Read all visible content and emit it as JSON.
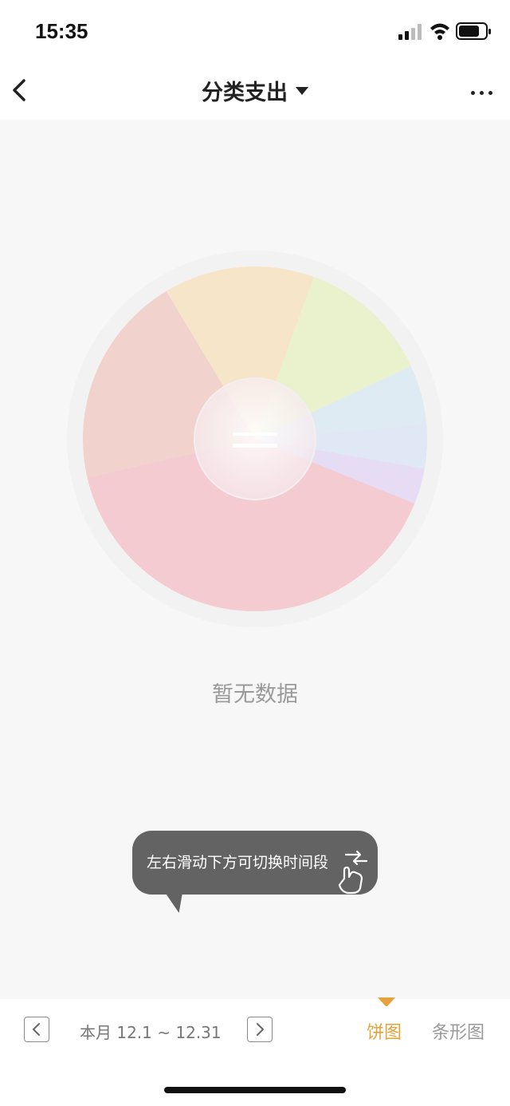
{
  "status_bar": {
    "time": "15:35"
  },
  "nav": {
    "title": "分类支出"
  },
  "main": {
    "empty_text": "暂无数据"
  },
  "tooltip": {
    "text": "左右滑动下方可切换时间段"
  },
  "bottom_bar": {
    "period_label": "本月 12.1 ~ 12.31",
    "tabs": [
      {
        "label": "饼图",
        "active": true
      },
      {
        "label": "条形图",
        "active": false
      }
    ]
  },
  "colors": {
    "active_tab": "#e5a23a",
    "placeholder_pie": [
      "#f3cbd0",
      "#f1d2cc",
      "#f6e5c8",
      "#eaf1cd",
      "#dfebf3",
      "#e0e7f5",
      "#e6dcf4"
    ]
  },
  "icons": {
    "back": "chevron-left-icon",
    "title_dropdown": "caret-down-icon",
    "more": "more-horizontal-icon",
    "prev": "chevron-left-icon",
    "next": "chevron-right-icon",
    "swipe": "swipe-hand-icon"
  }
}
